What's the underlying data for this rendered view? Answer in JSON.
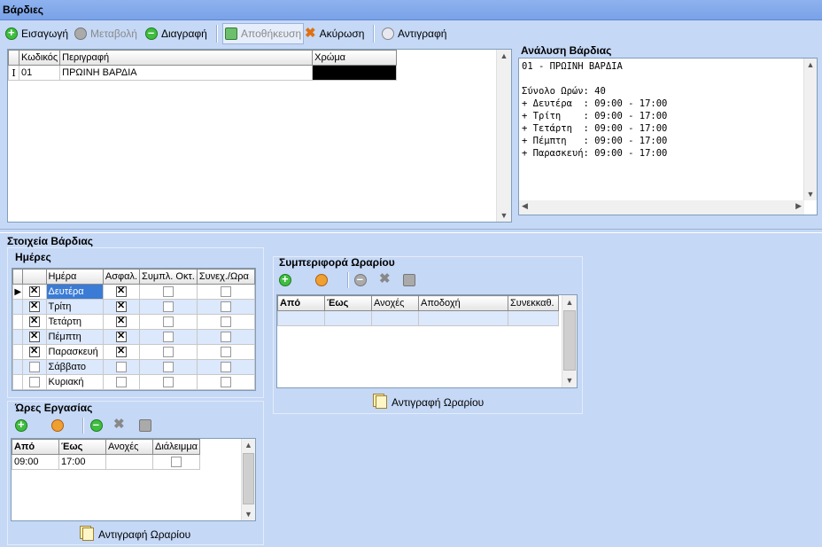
{
  "window": {
    "title": "Βάρδιες"
  },
  "toolbar": {
    "insert": "Εισαγωγή",
    "edit": "Μεταβολή",
    "delete": "Διαγραφή",
    "save": "Αποθήκευση",
    "cancel": "Ακύρωση",
    "copy": "Αντιγραφή"
  },
  "shifts_grid": {
    "columns": [
      "Κωδικός",
      "Περιγραφή",
      "Χρώμα"
    ],
    "rows": [
      {
        "code": "01",
        "description": "ΠΡΩΙΝΗ ΒΑΡΔΙΑ",
        "color": "#000000"
      }
    ]
  },
  "analysis": {
    "title": "Ανάλυση Βάρδιας",
    "text": "01 - ΠΡΩΙΝΗ ΒΑΡΔΙΑ\n\nΣύνολο Ωρών: 40\n+ Δευτέρα  : 09:00 - 17:00\n+ Τρίτη    : 09:00 - 17:00\n+ Τετάρτη  : 09:00 - 17:00\n+ Πέμπτη   : 09:00 - 17:00\n+ Παρασκευή: 09:00 - 17:00"
  },
  "shift_details": {
    "title": "Στοιχεία Βάρδιας"
  },
  "days": {
    "title": "Ημέρες",
    "columns": [
      "Ημέρα",
      "Ασφαλ.",
      "Συμπλ. Οκτ.",
      "Συνεχ./Ωρα"
    ],
    "rows": [
      {
        "on": true,
        "day": "Δευτέρα",
        "insured": true,
        "octa": false,
        "cont": false
      },
      {
        "on": true,
        "day": "Τρίτη",
        "insured": true,
        "octa": false,
        "cont": false
      },
      {
        "on": true,
        "day": "Τετάρτη",
        "insured": true,
        "octa": false,
        "cont": false
      },
      {
        "on": true,
        "day": "Πέμπτη",
        "insured": true,
        "octa": false,
        "cont": false
      },
      {
        "on": true,
        "day": "Παρασκευή",
        "insured": true,
        "octa": false,
        "cont": false
      },
      {
        "on": false,
        "day": "Σάββατο",
        "insured": false,
        "octa": false,
        "cont": false
      },
      {
        "on": false,
        "day": "Κυριακή",
        "insured": false,
        "octa": false,
        "cont": false
      }
    ]
  },
  "work_hours": {
    "title": "Ώρες Εργασίας",
    "columns": [
      "Από",
      "Έως",
      "Ανοχές",
      "Διάλειμμα"
    ],
    "rows": [
      {
        "from": "09:00",
        "to": "17:00",
        "tolerance": "",
        "break": false
      }
    ],
    "copy_label": "Αντιγραφή Ωραρίου"
  },
  "schedule_behavior": {
    "title": "Συμπεριφορά Ωραρίου",
    "columns": [
      "Από",
      "Έως",
      "Ανοχές",
      "Αποδοχή",
      "Συνεκκαθ."
    ],
    "copy_label": "Αντιγραφή Ωραρίου"
  },
  "colors": {
    "accent": "#c5d8f6",
    "titlebar": "#7aa2e8",
    "selected": "#3a7bd5"
  }
}
